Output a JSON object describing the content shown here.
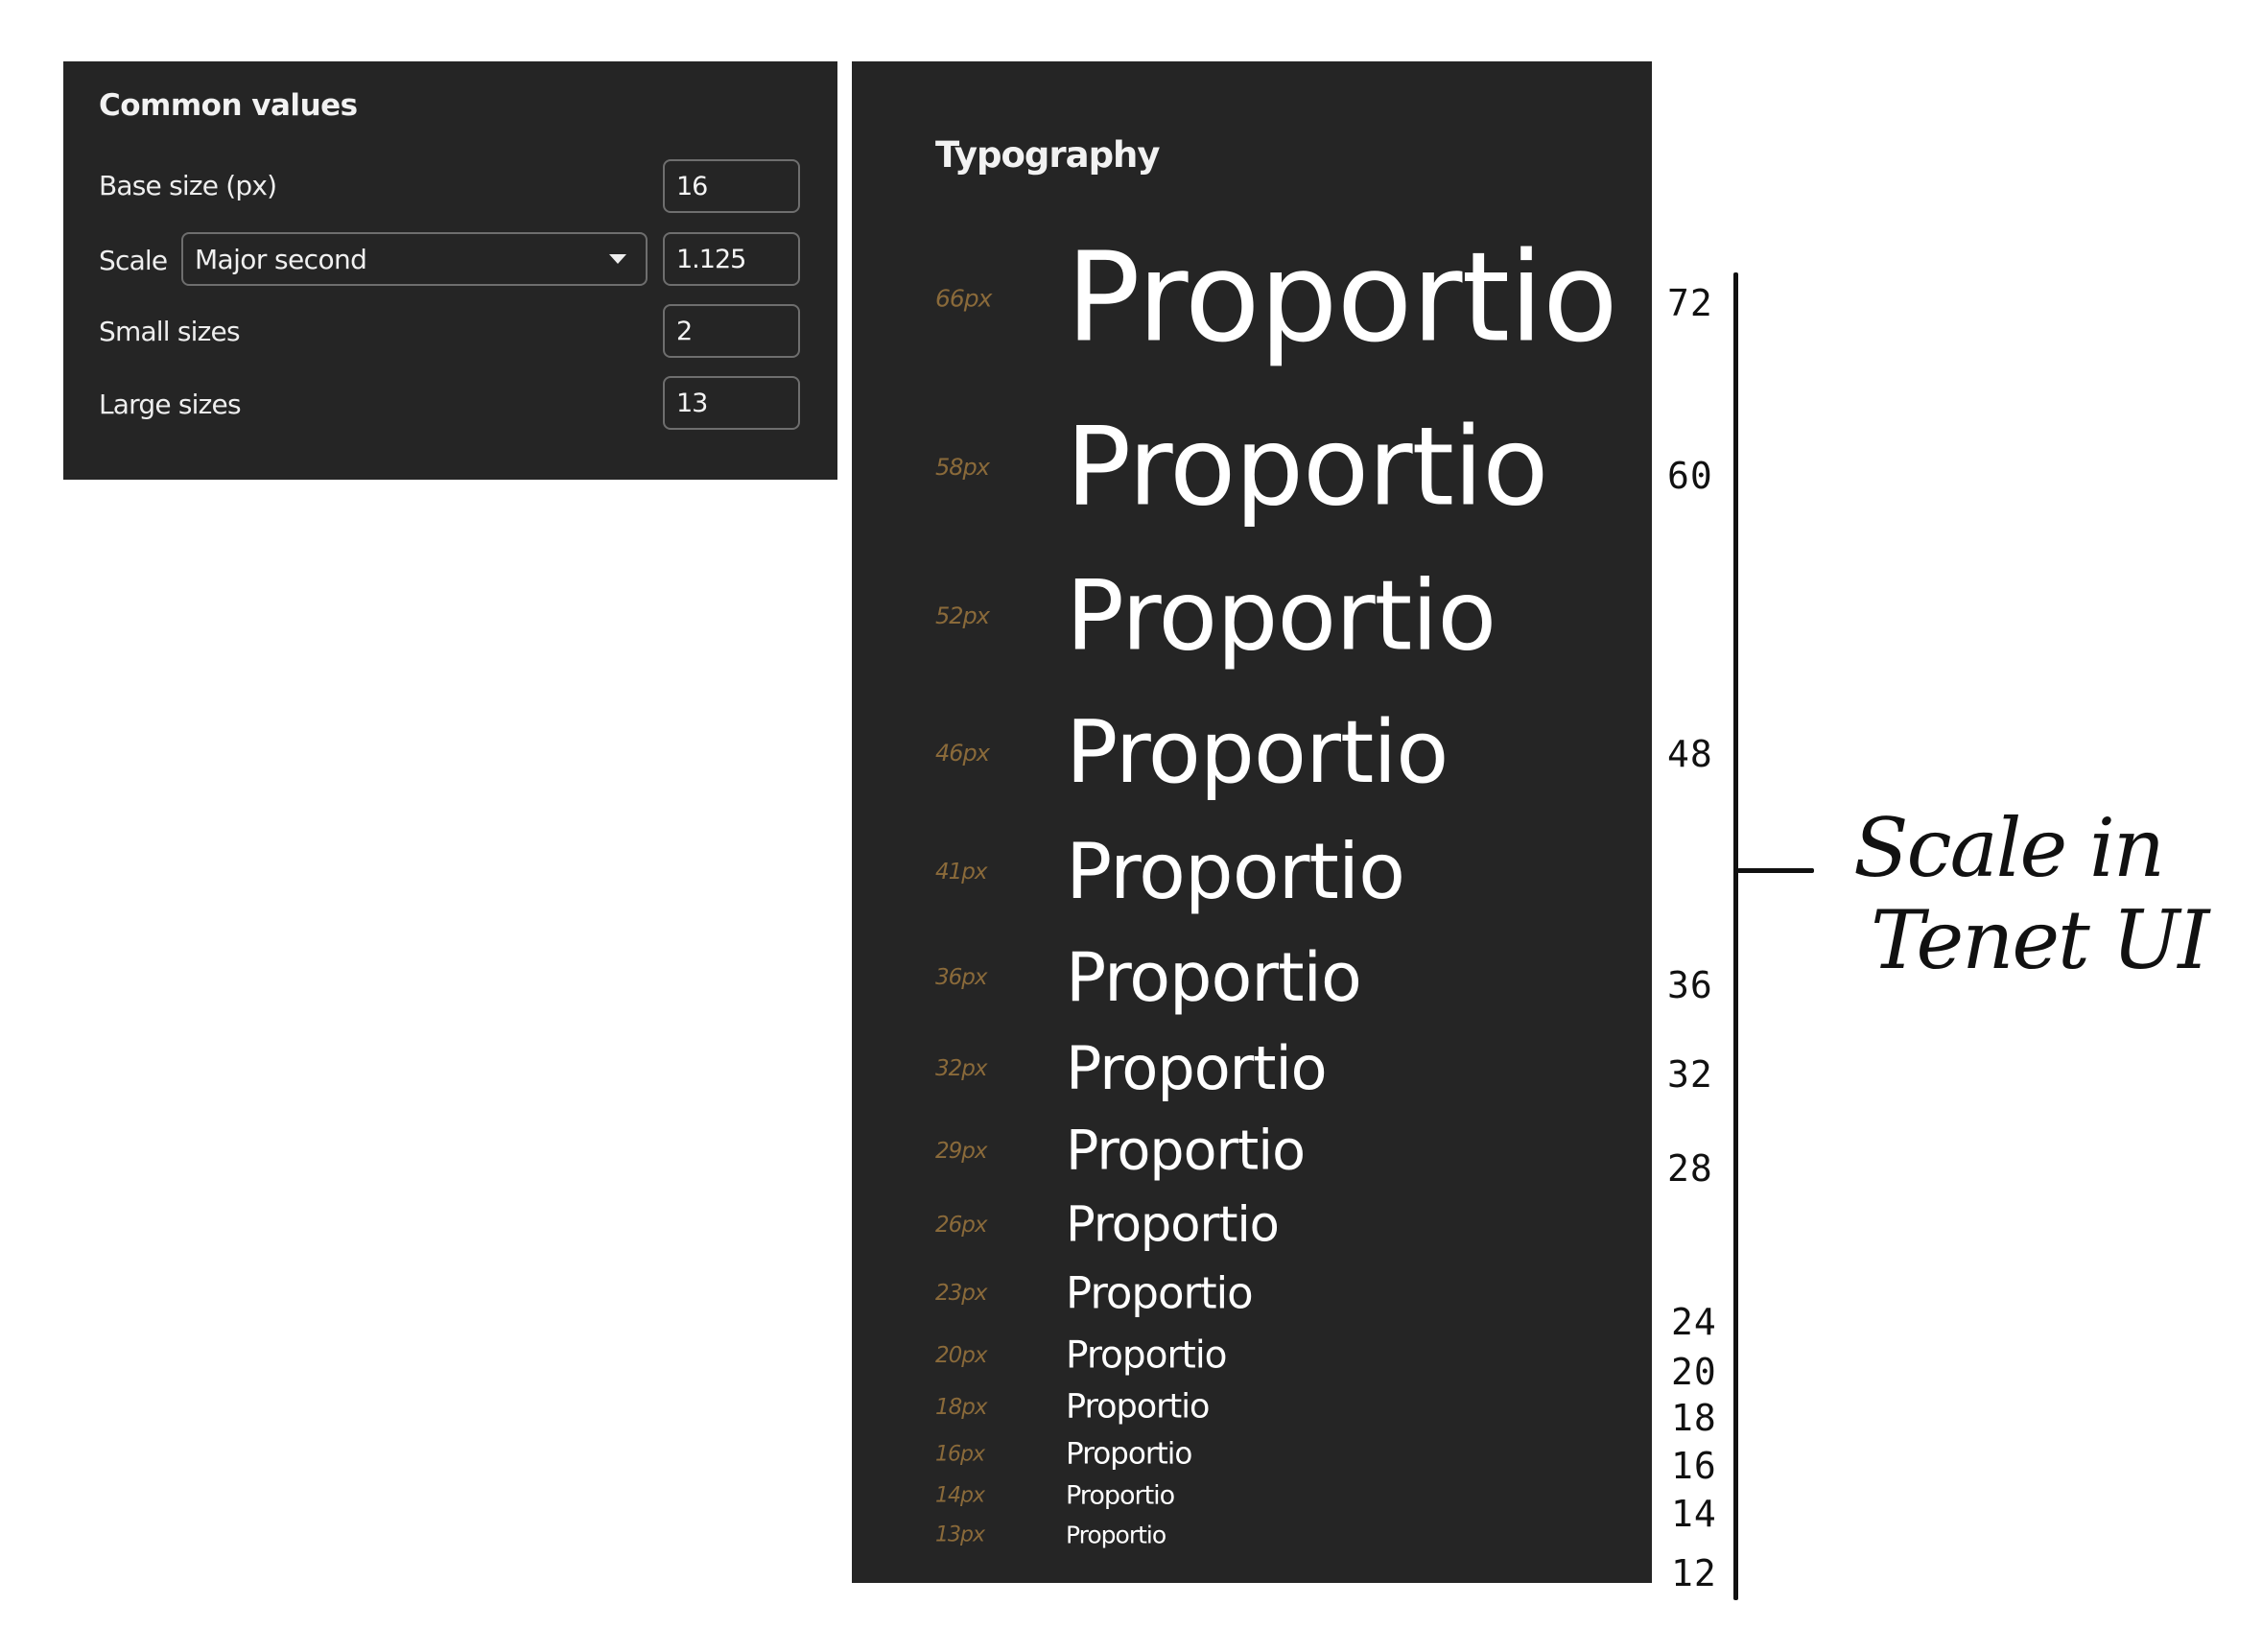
{
  "common_values": {
    "title": "Common values",
    "base_size_label": "Base size (px)",
    "base_size_value": "16",
    "scale_label": "Scale",
    "scale_select": "Major second",
    "scale_value": "1.125",
    "small_sizes_label": "Small sizes",
    "small_sizes_value": "2",
    "large_sizes_label": "Large sizes",
    "large_sizes_value": "13"
  },
  "typography": {
    "title": "Typography",
    "sample_word": "Proportio",
    "rows": [
      {
        "label": "66px",
        "size": 66
      },
      {
        "label": "58px",
        "size": 58
      },
      {
        "label": "52px",
        "size": 52
      },
      {
        "label": "46px",
        "size": 46
      },
      {
        "label": "41px",
        "size": 41
      },
      {
        "label": "36px",
        "size": 36
      },
      {
        "label": "32px",
        "size": 32
      },
      {
        "label": "29px",
        "size": 29
      },
      {
        "label": "26px",
        "size": 26
      },
      {
        "label": "23px",
        "size": 23
      },
      {
        "label": "20px",
        "size": 20
      },
      {
        "label": "18px",
        "size": 18
      },
      {
        "label": "16px",
        "size": 16
      },
      {
        "label": "14px",
        "size": 14
      },
      {
        "label": "13px",
        "size": 13
      }
    ]
  },
  "annotation": {
    "numbers": [
      "72",
      "60",
      "48",
      "36",
      "32",
      "28",
      "24",
      "20",
      "18",
      "16",
      "14",
      "12"
    ],
    "note_line1": "Scale in",
    "note_line2": "Tenet UI"
  },
  "colors": {
    "panel_bg": "#252525",
    "px_label": "#8a6a3a",
    "sample_text": "#ffffff"
  }
}
